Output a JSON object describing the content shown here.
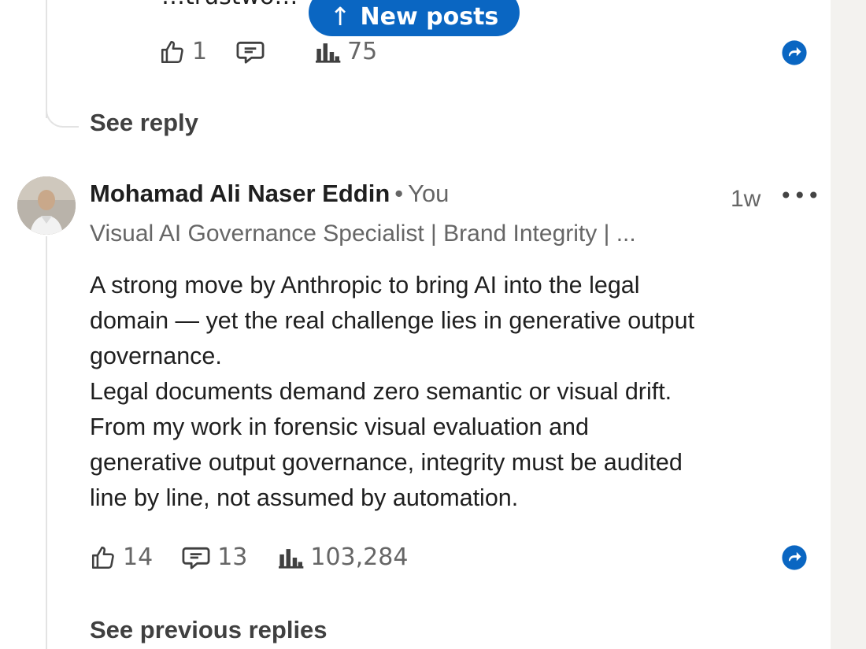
{
  "previous_reply": {
    "partial_text": "…trustwo…",
    "reactions": "1",
    "impressions": "75",
    "see_reply": "See reply"
  },
  "new_posts_button": {
    "label": "New posts",
    "arrow": "↑"
  },
  "comment": {
    "author_name": "Mohamad Ali Naser Eddin",
    "separator": "•",
    "you_label": "You",
    "timestamp": "1w",
    "more_label": "•••",
    "headline": "Visual AI Governance Specialist | Brand Integrity | ...",
    "lines": [
      "A strong move by Anthropic to bring AI into the legal",
      "domain — yet the real challenge lies in generative output",
      "governance.",
      "Legal documents demand zero semantic or visual drift.",
      "From my work in forensic visual evaluation and",
      "generative output governance, integrity must be audited",
      "line by line, not assumed by automation."
    ],
    "reactions": "14",
    "replies": "13",
    "impressions": "103,284"
  },
  "see_previous_replies": "See previous replies",
  "icons": {
    "like": "thumbs-up-icon",
    "comment": "comment-bubble-icon",
    "impressions": "bar-chart-icon",
    "share": "share-icon"
  },
  "colors": {
    "accent": "#0a66c2",
    "text": "#1f1f1f",
    "muted": "#666666"
  }
}
